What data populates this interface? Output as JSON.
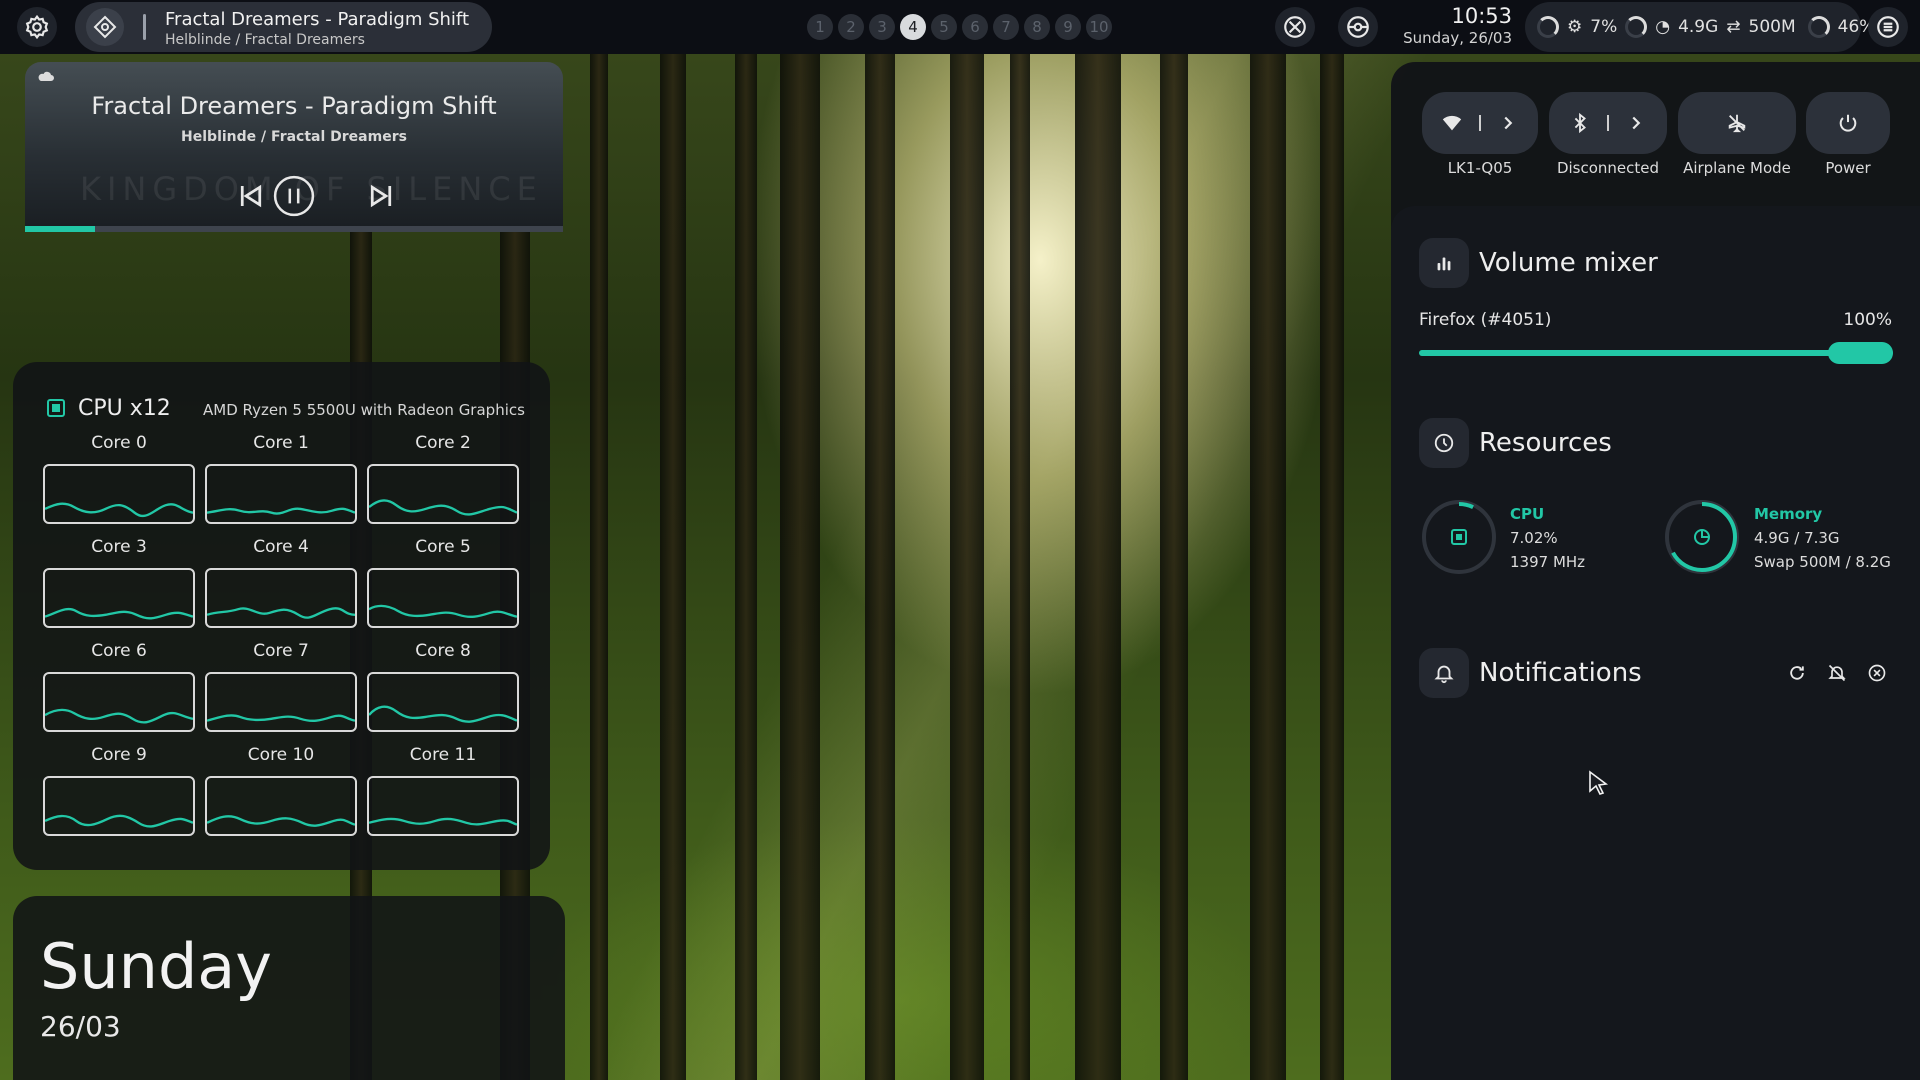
{
  "topbar": {
    "media_title": "Fractal Dreamers - Paradigm Shift",
    "media_subtitle": "Helblinde / Fractal Dreamers",
    "workspaces": [
      "1",
      "2",
      "3",
      "4",
      "5",
      "6",
      "7",
      "8",
      "9",
      "10"
    ],
    "active_workspace": "4",
    "time": "10:53",
    "date": "Sunday, 26/03",
    "cpu_percent": "7%",
    "memory": "4.9G",
    "swap": "500M",
    "battery": "46%",
    "icons": {
      "left": "settings-gear-icon",
      "media": "music-note-icon",
      "ws_left": "gamepad-icon",
      "ws_right": "steering-icon",
      "right_end": "menu-icon"
    }
  },
  "media_widget": {
    "title": "Fractal Dreamers - Paradigm Shift",
    "subtitle": "Helblinde / Fractal Dreamers",
    "background_text": "KINGDOM OF SILENCE",
    "progress": 0.13,
    "controls": {
      "prev": "previous-track-icon",
      "play": "pause-icon",
      "next": "next-track-icon"
    }
  },
  "cpu_widget": {
    "title": "CPU x12",
    "model": "AMD Ryzen 5 5500U with Radeon Graphics",
    "cores": [
      {
        "label": "Core 0"
      },
      {
        "label": "Core 1"
      },
      {
        "label": "Core 2"
      },
      {
        "label": "Core 3"
      },
      {
        "label": "Core 4"
      },
      {
        "label": "Core 5"
      },
      {
        "label": "Core 6"
      },
      {
        "label": "Core 7"
      },
      {
        "label": "Core 8"
      },
      {
        "label": "Core 9"
      },
      {
        "label": "Core 10"
      },
      {
        "label": "Core 11"
      }
    ]
  },
  "date_widget": {
    "day": "Sunday",
    "date": "26/03"
  },
  "quick_toggles": {
    "wifi_label": "LK1-Q05",
    "bluetooth_label": "Disconnected",
    "airplane_label": "Airplane Mode",
    "power_label": "Power"
  },
  "volume_mixer": {
    "title": "Volume mixer",
    "app": "Firefox (#4051)",
    "percent_label": "100%",
    "level": 1.0
  },
  "resources": {
    "title": "Resources",
    "cpu_name": "CPU",
    "cpu_usage": "7.02%",
    "cpu_freq": "1397 MHz",
    "cpu_fraction": 0.07,
    "mem_name": "Memory",
    "mem_usage": "4.9G / 7.3G",
    "swap_usage": "Swap 500M / 8.2G",
    "mem_fraction": 0.67
  },
  "notifications": {
    "title": "Notifications"
  },
  "colors": {
    "accent": "#22c7a6",
    "bar_bg": "#0c0e14",
    "panel_bg": "#14171c"
  }
}
